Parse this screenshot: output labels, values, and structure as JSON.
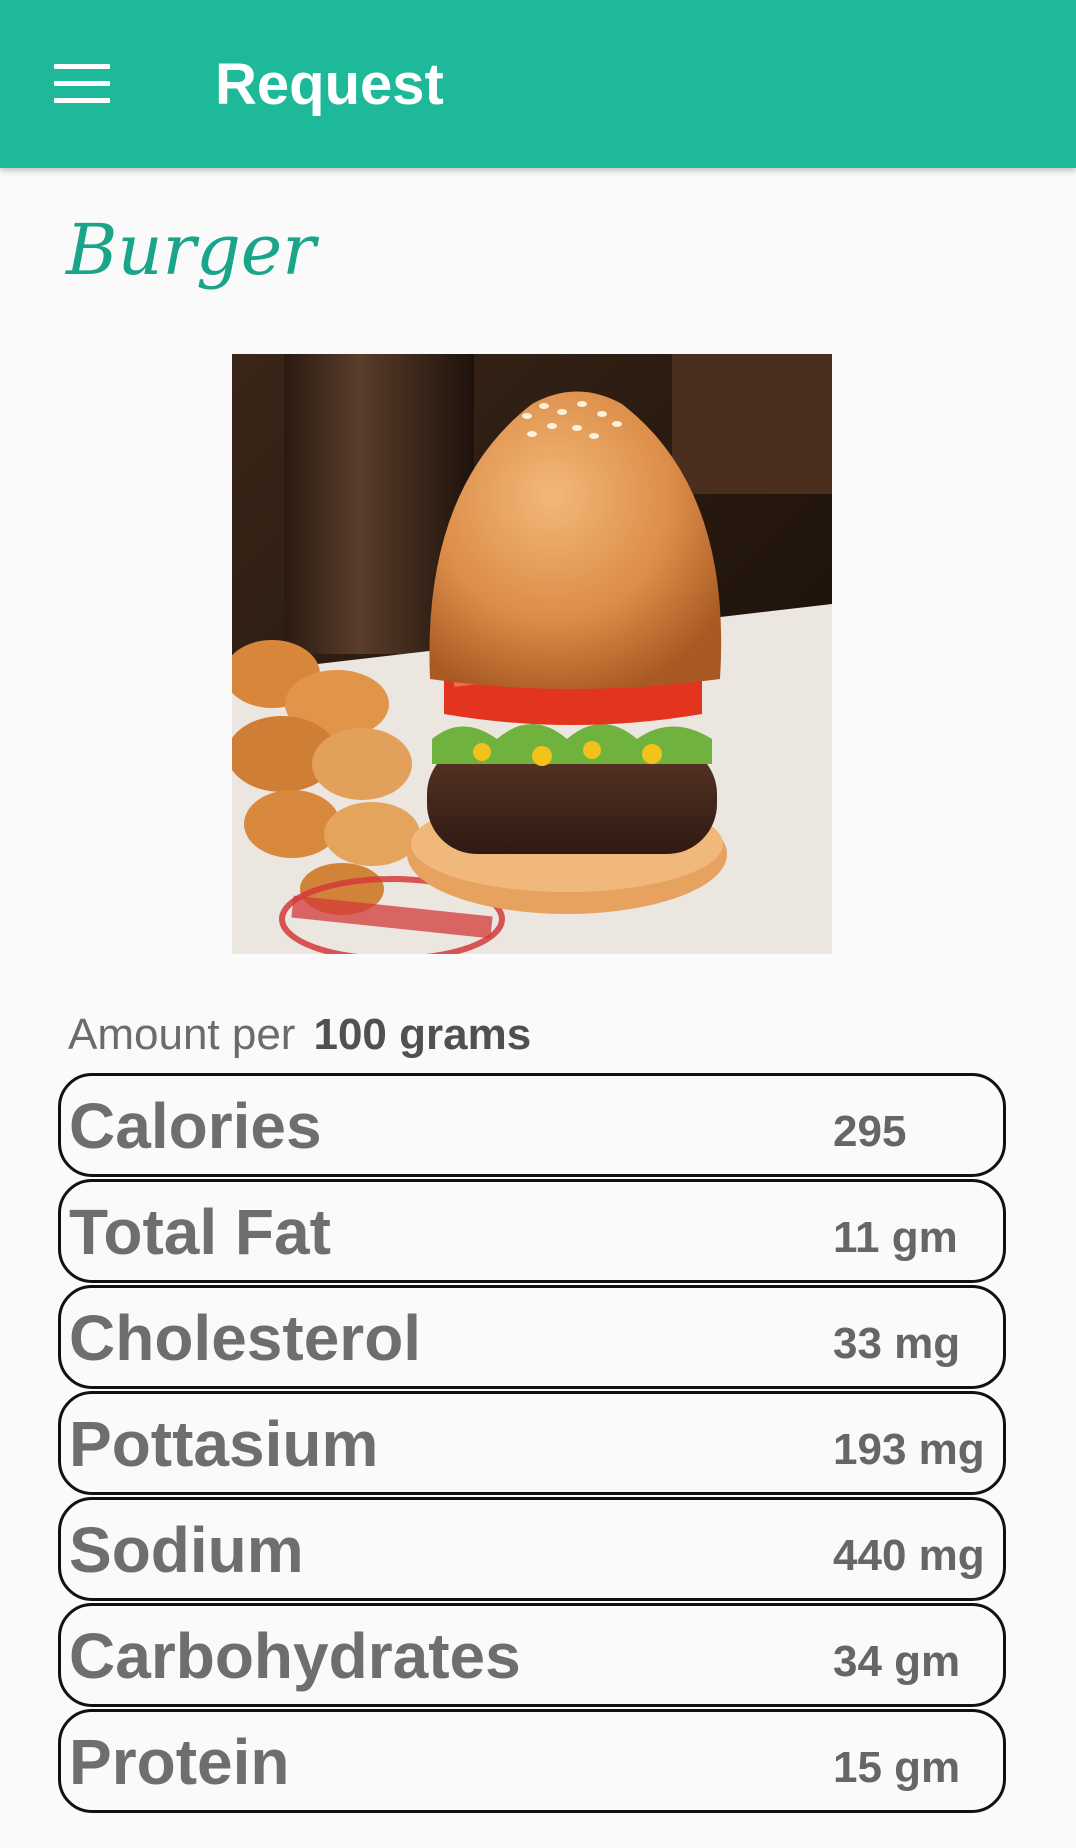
{
  "app_bar": {
    "title": "Request",
    "menu_icon": "hamburger-menu-icon",
    "background_color": "#1eb998"
  },
  "food": {
    "name": "Burger",
    "name_color": "#1aa58a",
    "image": "burger-with-fries-photo"
  },
  "serving": {
    "label": "Amount per",
    "quantity": "100 grams"
  },
  "nutrients": [
    {
      "label": "Calories",
      "value": "295"
    },
    {
      "label": "Total Fat",
      "value": "11 gm"
    },
    {
      "label": "Cholesterol",
      "value": "33 mg"
    },
    {
      "label": "Pottasium",
      "value": "193 mg"
    },
    {
      "label": "Sodium",
      "value": "440 mg"
    },
    {
      "label": "Carbohydrates",
      "value": "34 gm"
    },
    {
      "label": "Protein",
      "value": "15 gm"
    }
  ]
}
